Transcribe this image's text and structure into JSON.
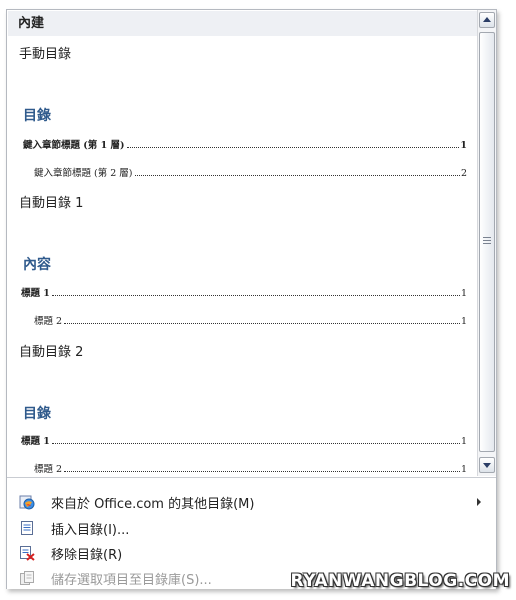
{
  "gallery": {
    "section_header": "內建",
    "entries": [
      {
        "title": "手動目錄",
        "heading": "目錄",
        "lines": [
          {
            "text": "鍵入章節標題 (第 1 層)",
            "page": "1"
          },
          {
            "text": "鍵入章節標題 (第 2 層)",
            "page": "2"
          }
        ]
      },
      {
        "title": "自動目錄 1",
        "heading": "內容",
        "lines": [
          {
            "text": "標題 1",
            "page": "1"
          },
          {
            "text": "標題 2",
            "page": "1"
          }
        ]
      },
      {
        "title": "自動目錄 2",
        "heading": "目錄",
        "lines": [
          {
            "text": "標題 1",
            "page": "1"
          },
          {
            "text": "標題 2",
            "page": "1"
          }
        ]
      }
    ]
  },
  "menu": {
    "items": [
      {
        "label": "來自於 Office.com 的其他目錄(M)",
        "icon": "office-globe-icon",
        "enabled": true
      },
      {
        "label": "插入目錄(I)...",
        "icon": "document-icon",
        "enabled": true
      },
      {
        "label": "移除目錄(R)",
        "icon": "remove-document-icon",
        "enabled": true
      },
      {
        "label": "儲存選取項目至目錄庫(S)...",
        "icon": "save-to-gallery-icon",
        "enabled": false
      }
    ]
  },
  "watermark": "RYANWANGBLOG.COM",
  "colors": {
    "heading": "#2f5a8c",
    "header_bg": "#eef0f4",
    "remove_x": "#d42020"
  }
}
